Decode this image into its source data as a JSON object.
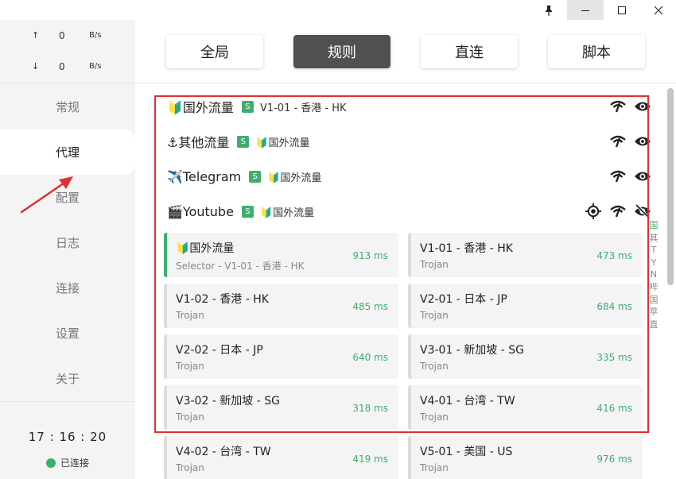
{
  "sidebar": {
    "upload": {
      "arrow": "↑",
      "value": "0",
      "unit": "B/s"
    },
    "download": {
      "arrow": "↓",
      "value": "0",
      "unit": "B/s"
    },
    "nav": [
      "常规",
      "代理",
      "配置",
      "日志",
      "连接",
      "设置",
      "关于"
    ],
    "active_index": 1,
    "clock": "17 : 16 : 20",
    "status": "已连接"
  },
  "modes": [
    "全局",
    "规则",
    "直连",
    "脚本"
  ],
  "active_mode": "规则",
  "groups": [
    {
      "icon": "🔰",
      "name": "国外流量",
      "badge": "S",
      "now": "V1-01 - 香港 - HK"
    },
    {
      "icon": "⚓",
      "name": "其他流量",
      "badge": "S",
      "now": "🔰国外流量"
    },
    {
      "icon": "✈️",
      "name": "Telegram",
      "badge": "S",
      "now": "🔰国外流量"
    },
    {
      "icon": "🎬",
      "name": "Youtube",
      "badge": "S",
      "now": "🔰国外流量"
    }
  ],
  "proxies": [
    {
      "name": "🔰国外流量",
      "type": "Selector - V1-01 - 香港 - HK",
      "delay": "913 ms",
      "selected": true
    },
    {
      "name": "V1-01 - 香港 - HK",
      "type": "Trojan",
      "delay": "473 ms"
    },
    {
      "name": "V1-02 - 香港 - HK",
      "type": "Trojan",
      "delay": "485 ms"
    },
    {
      "name": "V2-01 - 日本 - JP",
      "type": "Trojan",
      "delay": "684 ms"
    },
    {
      "name": "V2-02 - 日本 - JP",
      "type": "Trojan",
      "delay": "640 ms"
    },
    {
      "name": "V3-01 - 新加坡 - SG",
      "type": "Trojan",
      "delay": "335 ms"
    },
    {
      "name": "V3-02 - 新加坡 - SG",
      "type": "Trojan",
      "delay": "318 ms"
    },
    {
      "name": "V4-01 - 台湾 - TW",
      "type": "Trojan",
      "delay": "416 ms"
    },
    {
      "name": "V4-02 - 台湾 - TW",
      "type": "Trojan",
      "delay": "419 ms"
    },
    {
      "name": "V5-01 - 美国 - US",
      "type": "Trojan",
      "delay": "976 ms"
    }
  ],
  "alphabet": [
    "国",
    "其",
    "T",
    "Y",
    "N",
    "哔",
    "国",
    "苹",
    "直"
  ],
  "colors": {
    "accent_green": "#3fae6e",
    "highlight_red": "#e03131",
    "active_mode_bg": "#505050"
  }
}
